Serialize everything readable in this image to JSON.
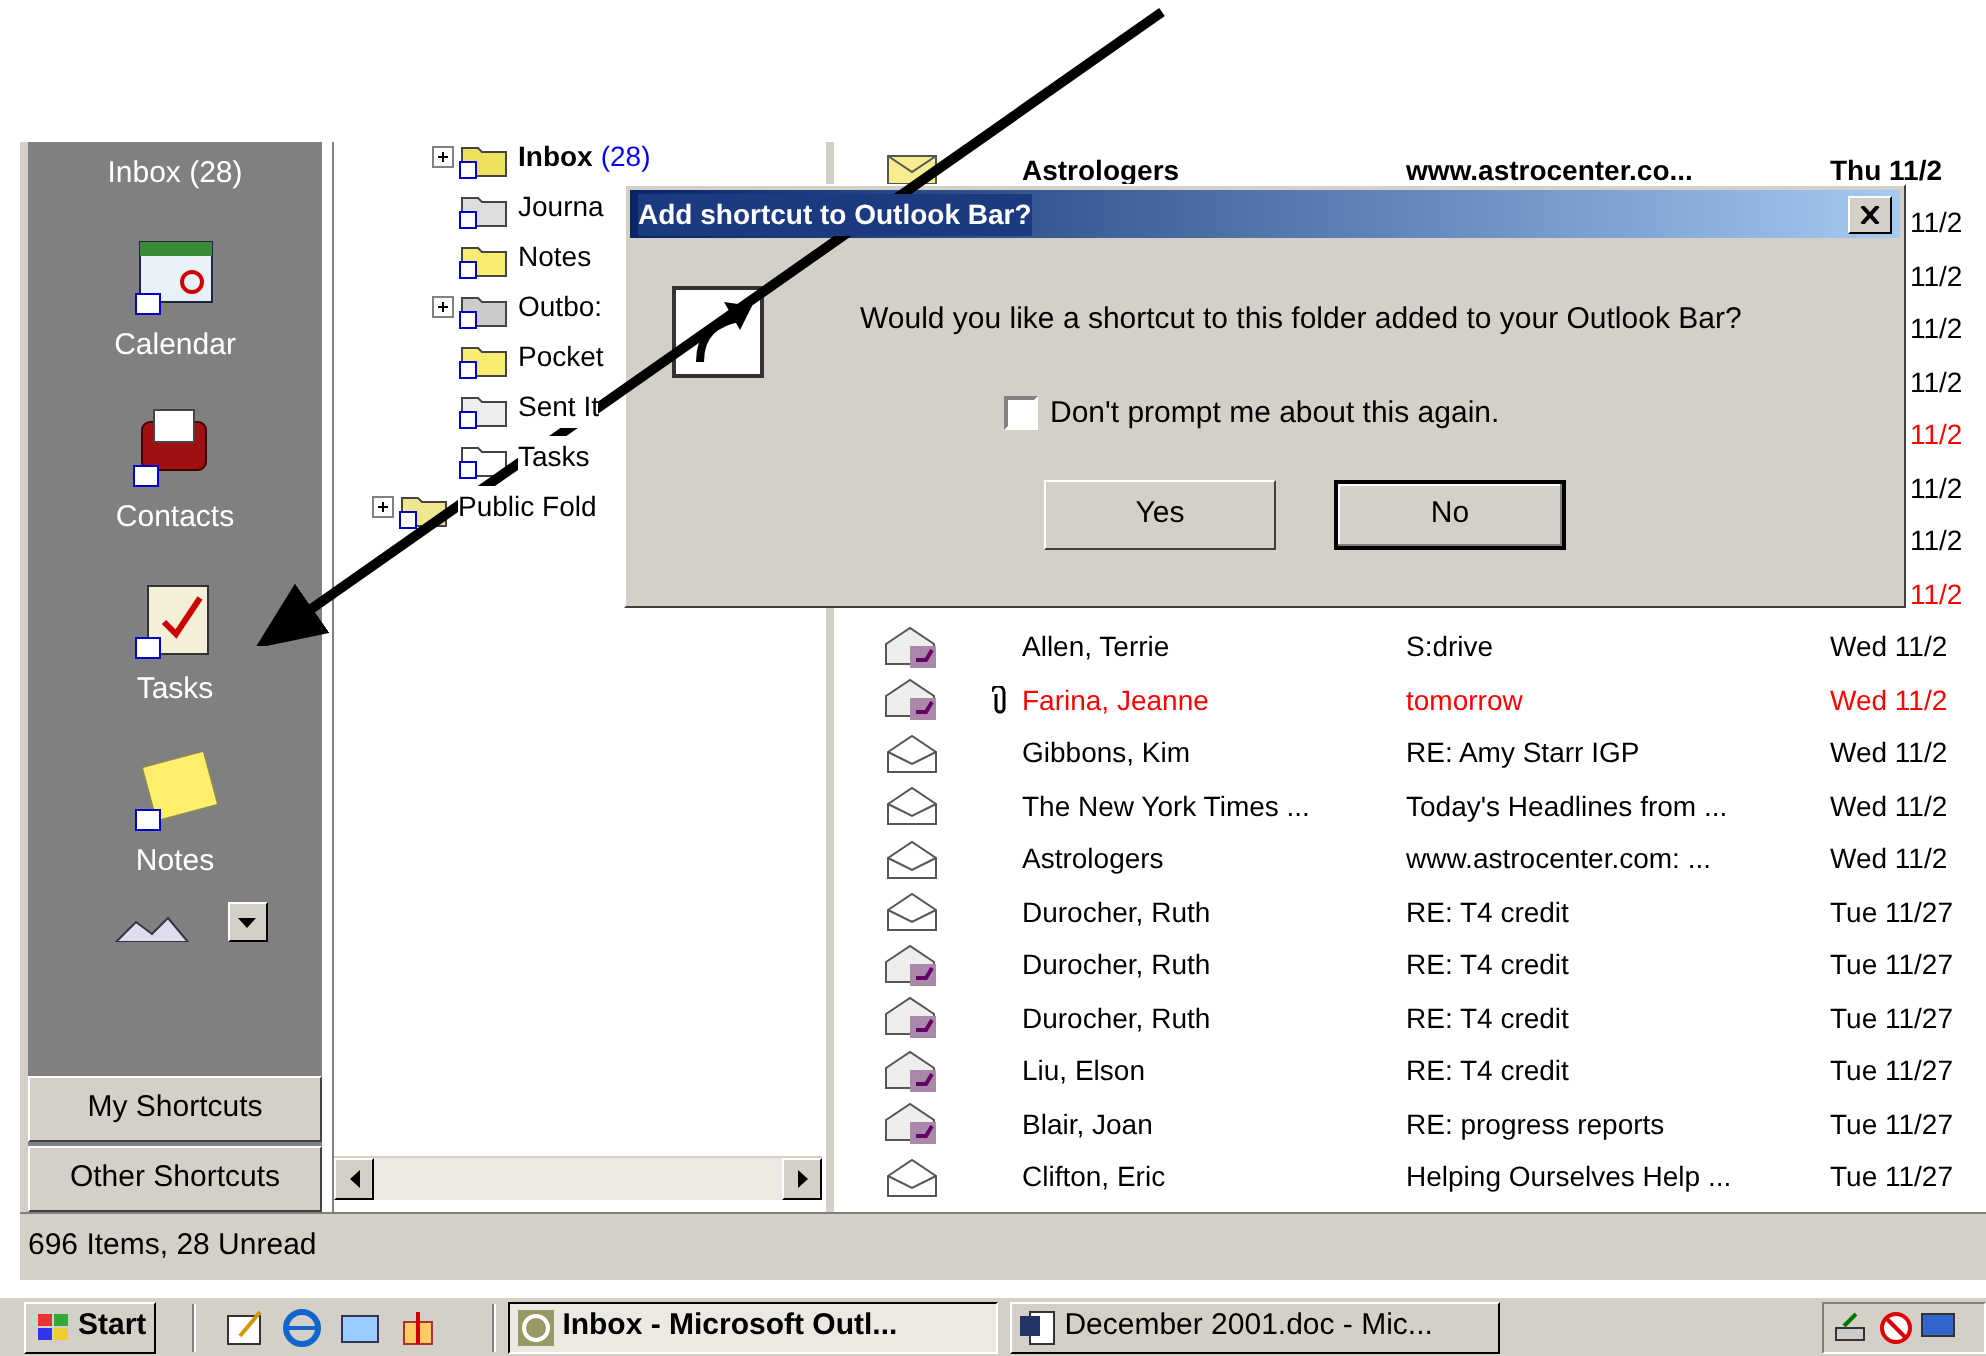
{
  "outlook_bar": {
    "items": [
      {
        "kind": "inbox",
        "label": "Inbox (28)"
      },
      {
        "kind": "calendar",
        "label": "Calendar"
      },
      {
        "kind": "contacts",
        "label": "Contacts"
      },
      {
        "kind": "tasks",
        "label": "Tasks"
      },
      {
        "kind": "notes",
        "label": "Notes"
      }
    ],
    "groups": [
      {
        "label": "My Shortcuts"
      },
      {
        "label": "Other Shortcuts"
      }
    ]
  },
  "folder_tree": [
    {
      "kind": "inbox",
      "label": "Inbox",
      "count": "(28)",
      "bold": true,
      "expandable": true,
      "indent": false
    },
    {
      "kind": "journal",
      "label": "Journa",
      "bold": false,
      "expandable": false,
      "indent": false
    },
    {
      "kind": "notes",
      "label": "Notes",
      "bold": false,
      "expandable": false,
      "indent": false
    },
    {
      "kind": "outbox",
      "label": "Outbo:",
      "bold": false,
      "expandable": true,
      "indent": false
    },
    {
      "kind": "notes",
      "label": "Pocket",
      "bold": false,
      "expandable": false,
      "indent": false
    },
    {
      "kind": "sent",
      "label": "Sent It",
      "bold": false,
      "expandable": false,
      "indent": false
    },
    {
      "kind": "tasks",
      "label": "Tasks",
      "bold": false,
      "expandable": false,
      "indent": false
    },
    {
      "kind": "public",
      "label": "Public Fold",
      "bold": false,
      "expandable": true,
      "indent": true
    }
  ],
  "messages": [
    {
      "kind": "unread",
      "attachment": false,
      "from": "Astrologers",
      "subject": "www.astrocenter.co...",
      "date": "Thu 11/2",
      "unread": true,
      "color": "#000000"
    },
    {
      "date": "11/2",
      "unread": false,
      "color": "#000000"
    },
    {
      "date": "11/2",
      "unread": false,
      "color": "#000000"
    },
    {
      "date": "11/2",
      "unread": false,
      "color": "#000000"
    },
    {
      "date": "11/2",
      "unread": false,
      "color": "#000000"
    },
    {
      "date": "11/2",
      "unread": false,
      "color": "#ff0000"
    },
    {
      "date": "11/2",
      "unread": false,
      "color": "#000000"
    },
    {
      "date": "11/2",
      "unread": false,
      "color": "#000000"
    },
    {
      "date": "11/2",
      "unread": false,
      "color": "#ff0000"
    },
    {
      "kind": "replied",
      "attachment": false,
      "from": "Allen, Terrie",
      "subject": "S:drive",
      "date": "Wed 11/2",
      "unread": false,
      "color": "#000000"
    },
    {
      "kind": "replied",
      "attachment": true,
      "from": "Farina, Jeanne",
      "subject": "tomorrow",
      "date": "Wed 11/2",
      "unread": false,
      "color": "#ff0000"
    },
    {
      "kind": "read",
      "attachment": false,
      "from": "Gibbons, Kim",
      "subject": "RE: Amy Starr IGP",
      "date": "Wed 11/2",
      "unread": false,
      "color": "#000000"
    },
    {
      "kind": "read",
      "attachment": false,
      "from": "The New York Times ...",
      "subject": "Today's Headlines from ...",
      "date": "Wed 11/2",
      "unread": false,
      "color": "#000000"
    },
    {
      "kind": "read",
      "attachment": false,
      "from": "Astrologers",
      "subject": "www.astrocenter.com: ...",
      "date": "Wed 11/2",
      "unread": false,
      "color": "#000000"
    },
    {
      "kind": "read",
      "attachment": false,
      "from": "Durocher, Ruth",
      "subject": "RE: T4 credit",
      "date": "Tue 11/27",
      "unread": false,
      "color": "#000000"
    },
    {
      "kind": "replied",
      "attachment": false,
      "from": "Durocher, Ruth",
      "subject": "RE: T4 credit",
      "date": "Tue 11/27",
      "unread": false,
      "color": "#000000"
    },
    {
      "kind": "replied",
      "attachment": false,
      "from": "Durocher, Ruth",
      "subject": "RE: T4 credit",
      "date": "Tue 11/27",
      "unread": false,
      "color": "#000000"
    },
    {
      "kind": "replied",
      "attachment": false,
      "from": "Liu, Elson",
      "subject": "RE: T4 credit",
      "date": "Tue 11/27",
      "unread": false,
      "color": "#000000"
    },
    {
      "kind": "replied",
      "attachment": false,
      "from": "Blair, Joan",
      "subject": "RE: progress reports",
      "date": "Tue 11/27",
      "unread": false,
      "color": "#000000"
    },
    {
      "kind": "read",
      "attachment": false,
      "from": "Clifton, Eric",
      "subject": "Helping Ourselves Help ...",
      "date": "Tue 11/27",
      "unread": false,
      "color": "#000000"
    }
  ],
  "dialog": {
    "title": "Add shortcut to Outlook Bar?",
    "message": "Would you like a shortcut to this folder added to your Outlook Bar?",
    "checkbox": {
      "label": "Don't prompt me about this again.",
      "checked": false
    },
    "buttons": [
      {
        "label": "Yes",
        "default": false
      },
      {
        "label": "No",
        "default": true
      }
    ]
  },
  "status_bar": "696 Items, 28 Unread",
  "taskbar": {
    "start": "Start",
    "tasks": [
      {
        "kind": "outlook",
        "label": "Inbox - Microsoft Outl...",
        "selected": true
      },
      {
        "kind": "word",
        "label": "December 2001.doc - Mic...",
        "selected": false
      }
    ]
  }
}
